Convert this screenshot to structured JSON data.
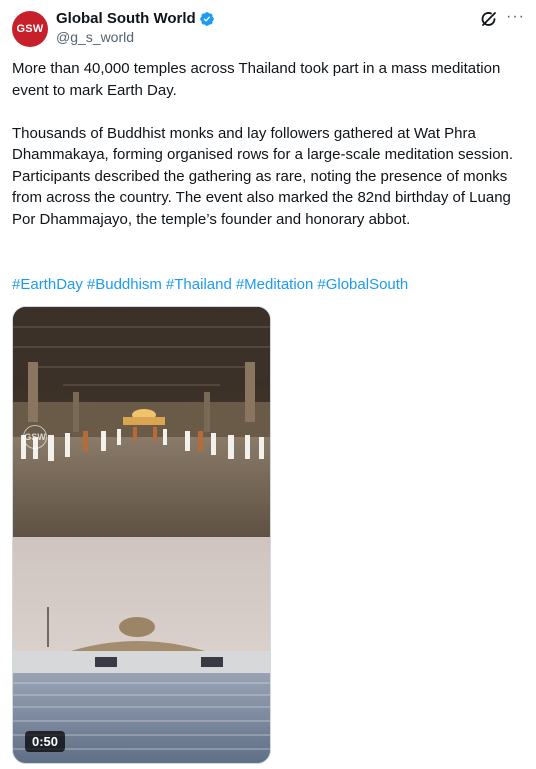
{
  "author": {
    "avatar_text": "GSW",
    "display_name": "Global South World",
    "handle": "@g_s_world",
    "verified": true
  },
  "icons": {
    "grok": "grok-icon",
    "more": "more-icon",
    "verified": "verified-badge-icon"
  },
  "post": {
    "paragraph_1": "More than 40,000 temples across Thailand took part in a mass meditation event to mark Earth Day.",
    "paragraph_2": "Thousands of Buddhist monks and lay followers gathered at Wat Phra Dhammakaya, forming organised rows for a large-scale meditation session. Participants described the gathering as rare, noting the presence of monks from across the country. The event also marked the 82nd birthday of Luang Por Dhammajayo, the temple’s founder and honorary abbot.",
    "hashtags": [
      "#EarthDay",
      "#Buddhism",
      "#Thailand",
      "#Meditation",
      "#GlobalSouth"
    ]
  },
  "media": {
    "watermark": "GSW",
    "duration": "0:50"
  },
  "colors": {
    "link": "#1d9bf0",
    "avatar": "#c8202b",
    "verified": "#1d9bf0",
    "muted": "#536471"
  }
}
